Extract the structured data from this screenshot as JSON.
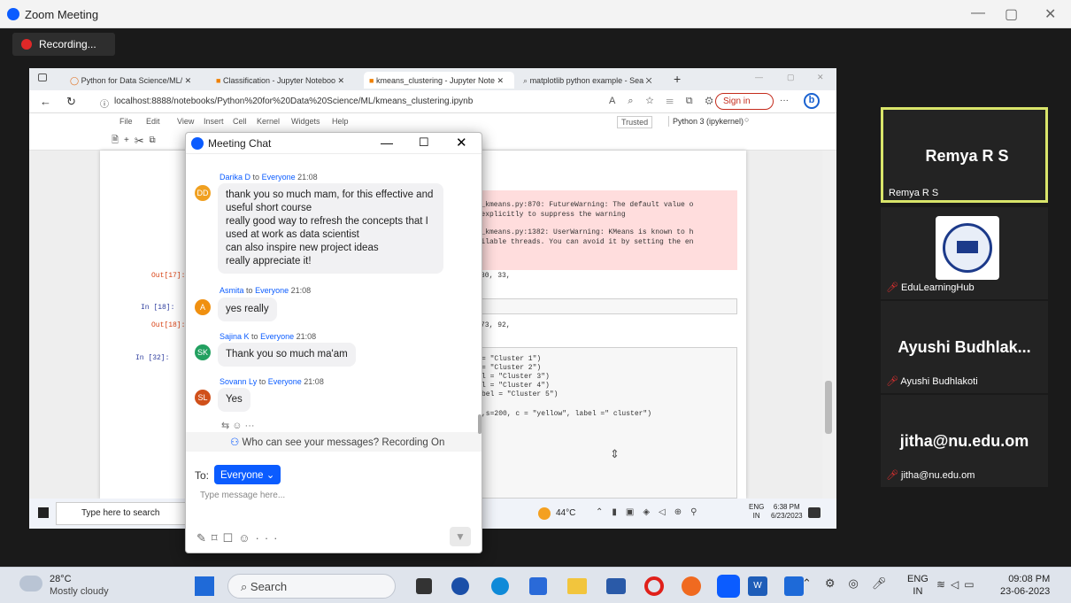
{
  "zoom": {
    "title": "Zoom Meeting",
    "recording": "Recording..."
  },
  "browser": {
    "tabs": [
      "Python for Data Science/ML/",
      "Classification - Jupyter Noteboo",
      "kmeans_clustering - Jupyter Note",
      "matplotlib python example - Sea"
    ],
    "url": "localhost:8888/notebooks/Python%20for%20Data%20Science/ML/kmeans_clustering.ipynb",
    "sign_in": "Sign in"
  },
  "jupyter": {
    "menu": [
      "File",
      "Edit",
      "View",
      "Insert",
      "Cell",
      "Kernel",
      "Widgets",
      "Help"
    ],
    "trusted": "Trusted",
    "kernel": "Python 3 (ipykernel)",
    "prompts": {
      "out17": "Out[17]:",
      "in18": "In [18]:",
      "out18": "Out[18]:",
      "in32": "In [32]:"
    },
    "warn1": "cluster\\_kmeans.py:870: FutureWarning: The default value o",
    "warn2": "n_init` explicitly to suppress the warning",
    "warn3": "cluster\\_kmeans.py:1382: UserWarning: KMeans is known to h",
    "warn4": "than available threads. You can avoid it by setting the en",
    "out17_val": "30, 33,",
    "out18_val": "73, 92,",
    "code1": "= \"Cluster 1\")",
    "code2": "= \"Cluster 2\")",
    "code3": "l = \"Cluster 3\")",
    "code4": "l = \"Cluster 4\")",
    "code5": "bel = \"Cluster 5\")",
    "code6": ",s=200, c = \"yellow\", label =\" cluster\")"
  },
  "inner_taskbar": {
    "search": "Type here to search",
    "temp": "44°C",
    "lang1": "ENG",
    "lang2": "IN",
    "time": "6:38 PM",
    "date": "6/23/2023"
  },
  "chat": {
    "title": "Meeting Chat",
    "messages": [
      {
        "sender": "Darika D",
        "to": "to",
        "target": "Everyone",
        "time": "21:08",
        "initials": "DD",
        "color": "#f0a020",
        "lines": [
          "thank you so much mam, for this effective and",
          "useful short course",
          "really good way to refresh the concepts that I",
          "used at work as data scientist",
          "can also inspire new project ideas",
          "really appreciate it!"
        ]
      },
      {
        "sender": "Asmita",
        "to": "to",
        "target": "Everyone",
        "time": "21:08",
        "initials": "A",
        "color": "#f09010",
        "lines": [
          "yes really"
        ]
      },
      {
        "sender": "Sajina K",
        "to": "to",
        "target": "Everyone",
        "time": "21:08",
        "initials": "SK",
        "color": "#22a060",
        "lines": [
          "Thank you so much ma'am"
        ]
      },
      {
        "sender": "Sovann Ly",
        "to": "to",
        "target": "Everyone",
        "time": "21:08",
        "initials": "SL",
        "color": "#d0501a",
        "lines": [
          "Yes"
        ]
      }
    ],
    "privacy": "Who can see your messages? Recording On",
    "to_label": "To:",
    "recipient": "Everyone",
    "placeholder": "Type message here..."
  },
  "participants": [
    {
      "big": "Remya R S",
      "name": "Remya R S",
      "active": true
    },
    {
      "big": "",
      "name": "EduLearningHub",
      "logo": true
    },
    {
      "big": "Ayushi  Budhlak...",
      "name": "Ayushi Budhlakoti"
    },
    {
      "big": "jitha@nu.edu.om",
      "name": "jitha@nu.edu.om"
    }
  ],
  "taskbar": {
    "weather_temp": "28°C",
    "weather_desc": "Mostly cloudy",
    "search": "Search",
    "lang1": "ENG",
    "lang2": "IN",
    "time": "09:08 PM",
    "date": "23-06-2023"
  }
}
